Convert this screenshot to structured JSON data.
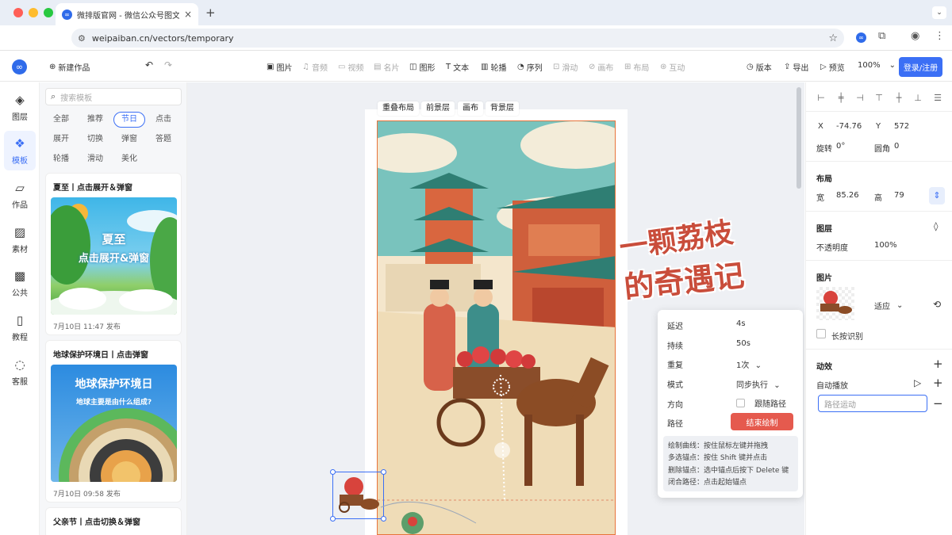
{
  "browser": {
    "tab_title": "微排版官网 - 微信公众号图文排",
    "tab_close": "×",
    "new_tab": "+",
    "url": "weipaiban.cn/vectors/temporary",
    "favicon_glyph": "∞"
  },
  "header": {
    "new_work": "新建作品",
    "tools": [
      {
        "label": "图片",
        "icon": "image-icon",
        "enabled": true
      },
      {
        "label": "音频",
        "icon": "music-icon",
        "enabled": false
      },
      {
        "label": "视频",
        "icon": "video-icon",
        "enabled": false
      },
      {
        "label": "名片",
        "icon": "card-icon",
        "enabled": false
      },
      {
        "label": "图形",
        "icon": "shape-icon",
        "enabled": true
      },
      {
        "label": "文本",
        "icon": "text-icon",
        "enabled": true
      },
      {
        "label": "轮播",
        "icon": "carousel-icon",
        "enabled": true
      },
      {
        "label": "序列",
        "icon": "sequence-icon",
        "enabled": true
      },
      {
        "label": "滑动",
        "icon": "slide-icon",
        "enabled": false
      },
      {
        "label": "画布",
        "icon": "canvas-icon",
        "enabled": false
      },
      {
        "label": "布局",
        "icon": "layout-icon",
        "enabled": false
      },
      {
        "label": "互动",
        "icon": "interact-icon",
        "enabled": false
      }
    ],
    "version": "版本",
    "export": "导出",
    "preview": "预览",
    "zoom": "100%",
    "login": "登录/注册"
  },
  "leftnav": [
    {
      "label": "图层",
      "icon": "layers-icon",
      "active": false
    },
    {
      "label": "模板",
      "icon": "template-icon",
      "active": true
    },
    {
      "label": "作品",
      "icon": "folder-icon",
      "active": false
    },
    {
      "label": "素材",
      "icon": "material-icon",
      "active": false
    },
    {
      "label": "公共",
      "icon": "public-icon",
      "active": false
    },
    {
      "label": "教程",
      "icon": "book-icon",
      "active": false
    },
    {
      "label": "客服",
      "icon": "chat-icon",
      "active": false
    }
  ],
  "templates": {
    "search_placeholder": "搜索模板",
    "chips": [
      "全部",
      "推荐",
      "节日",
      "点击",
      "展开",
      "切换",
      "弹窗",
      "答题",
      "轮播",
      "滑动",
      "美化"
    ],
    "active_chip": "节日",
    "cards": [
      {
        "title": "夏至丨点击展开＆弹窗",
        "image_text_1": "夏至",
        "image_text_2": "点击展开&弹窗",
        "date": "7月10日 11:47 发布"
      },
      {
        "title": "地球保护环境日丨点击弹窗",
        "image_text_1": "地球保护环境日",
        "image_text_2": "地球主要是由什么组成?",
        "date": "7月10日 09:58 发布"
      },
      {
        "title": "父亲节丨点击切换＆弹窗"
      }
    ]
  },
  "canvas": {
    "tabs": [
      "重叠布局",
      "前景层",
      "画布",
      "背景层"
    ],
    "overlay_title_1": "一颗荔枝",
    "overlay_title_2": "的奇遇记"
  },
  "popover": {
    "rows": [
      {
        "label": "延迟",
        "value": "4s"
      },
      {
        "label": "持续",
        "value": "50s"
      },
      {
        "label": "重复",
        "value": "1次"
      },
      {
        "label": "模式",
        "value": "同步执行"
      },
      {
        "label": "方向",
        "value": "跟随路径"
      },
      {
        "label": "路径",
        "value": ""
      }
    ],
    "end_button": "结束绘制",
    "tips": [
      "绘制曲线：按住鼠标左键并拖拽",
      "多选锚点：按住 Shift 键并点击",
      "删除锚点：选中锚点后按下 Delete 键",
      "闭合路径：点击起始锚点"
    ]
  },
  "props": {
    "x_label": "X",
    "x": "-74.76",
    "y_label": "Y",
    "y": "572",
    "rotate_label": "旋转",
    "rotate": "0°",
    "radius_label": "圆角",
    "radius": "0",
    "layout_title": "布局",
    "w_label": "宽",
    "w": "85.26",
    "h_label": "高",
    "h": "79",
    "layer_title": "图层",
    "opacity_label": "不透明度",
    "opacity": "100%",
    "image_title": "图片",
    "fit": "适应",
    "longpress": "长按识别",
    "anim_title": "动效",
    "autoplay": "自动播放",
    "path_motion": "路径运动"
  },
  "colors": {
    "accent": "#3b6ff5",
    "danger": "#e55a4e",
    "selection": "#e8743b"
  }
}
